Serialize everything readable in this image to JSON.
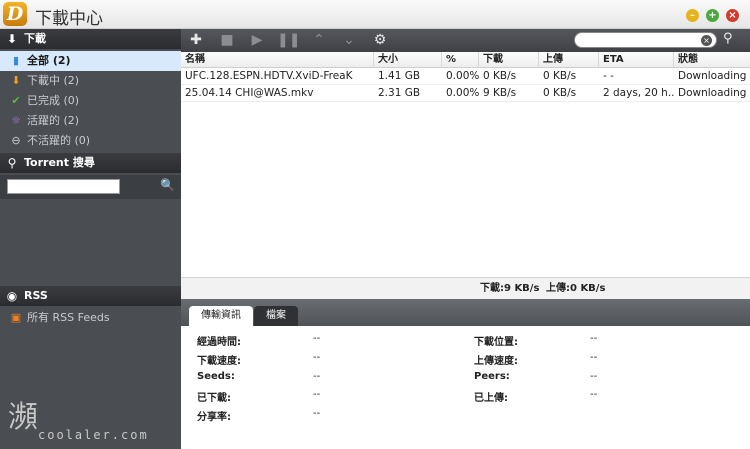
{
  "window": {
    "title": "下載中心",
    "logo_letter": "D"
  },
  "sidebar": {
    "download_section": "下載",
    "filters": [
      {
        "label": "全部 (2)",
        "icon": "list-icon",
        "color": "#3b8ad8",
        "active": true
      },
      {
        "label": "下載中 (2)",
        "icon": "arrow-down-icon",
        "color": "#f0a020"
      },
      {
        "label": "已完成 (0)",
        "icon": "check-icon",
        "color": "#5cb83a"
      },
      {
        "label": "活躍的 (2)",
        "icon": "sun-icon",
        "color": "#b47fdc"
      },
      {
        "label": "不活躍的 (0)",
        "icon": "minus-circle-icon",
        "color": "#d0d0d0"
      }
    ],
    "search_section": "Torrent 搜尋",
    "search_value": "",
    "rss_section": "RSS",
    "rss_items": [
      {
        "label": "所有 RSS Feeds",
        "icon": "rss-icon",
        "color": "#f08020"
      }
    ]
  },
  "toolbar": {
    "buttons": [
      "add-icon",
      "delete-icon",
      "play-icon",
      "pause-icon",
      "move-up-icon",
      "move-down-icon",
      "settings-icon"
    ],
    "search_value": ""
  },
  "table": {
    "columns": [
      "名稱",
      "大小",
      "%",
      "下載",
      "上傳",
      "ETA",
      "狀態"
    ],
    "rows": [
      {
        "name": "UFC.128.ESPN.HDTV.XviD-FreaK",
        "size": "1.41 GB",
        "percent": "0.00%",
        "down": "0 KB/s",
        "up": "0 KB/s",
        "eta": "- -",
        "status": "Downloading"
      },
      {
        "name": "25.04.14 CHI@WAS.mkv",
        "size": "2.31 GB",
        "percent": "0.00%",
        "down": "9 KB/s",
        "up": "0 KB/s",
        "eta": "2 days, 20 h...",
        "status": "Downloading"
      }
    ]
  },
  "status": {
    "down": "下載:9 KB/s",
    "up": "上傳:0 KB/s"
  },
  "details": {
    "tabs": [
      "傳輸資訊",
      "檔案"
    ],
    "left": [
      {
        "label": "經過時間:",
        "value": "--"
      },
      {
        "label": "下載速度:",
        "value": "--"
      },
      {
        "label": "Seeds:",
        "value": "--"
      },
      {
        "label": "已下載:",
        "value": "--"
      },
      {
        "label": "分享率:",
        "value": "--"
      }
    ],
    "right": [
      {
        "label": "下載位置:",
        "value": "--"
      },
      {
        "label": "上傳速度:",
        "value": "--"
      },
      {
        "label": "Peers:",
        "value": "--"
      },
      {
        "label": "已上傳:",
        "value": "--"
      }
    ]
  },
  "watermark": {
    "glyph": "瀕",
    "text": "coolaler.com"
  }
}
